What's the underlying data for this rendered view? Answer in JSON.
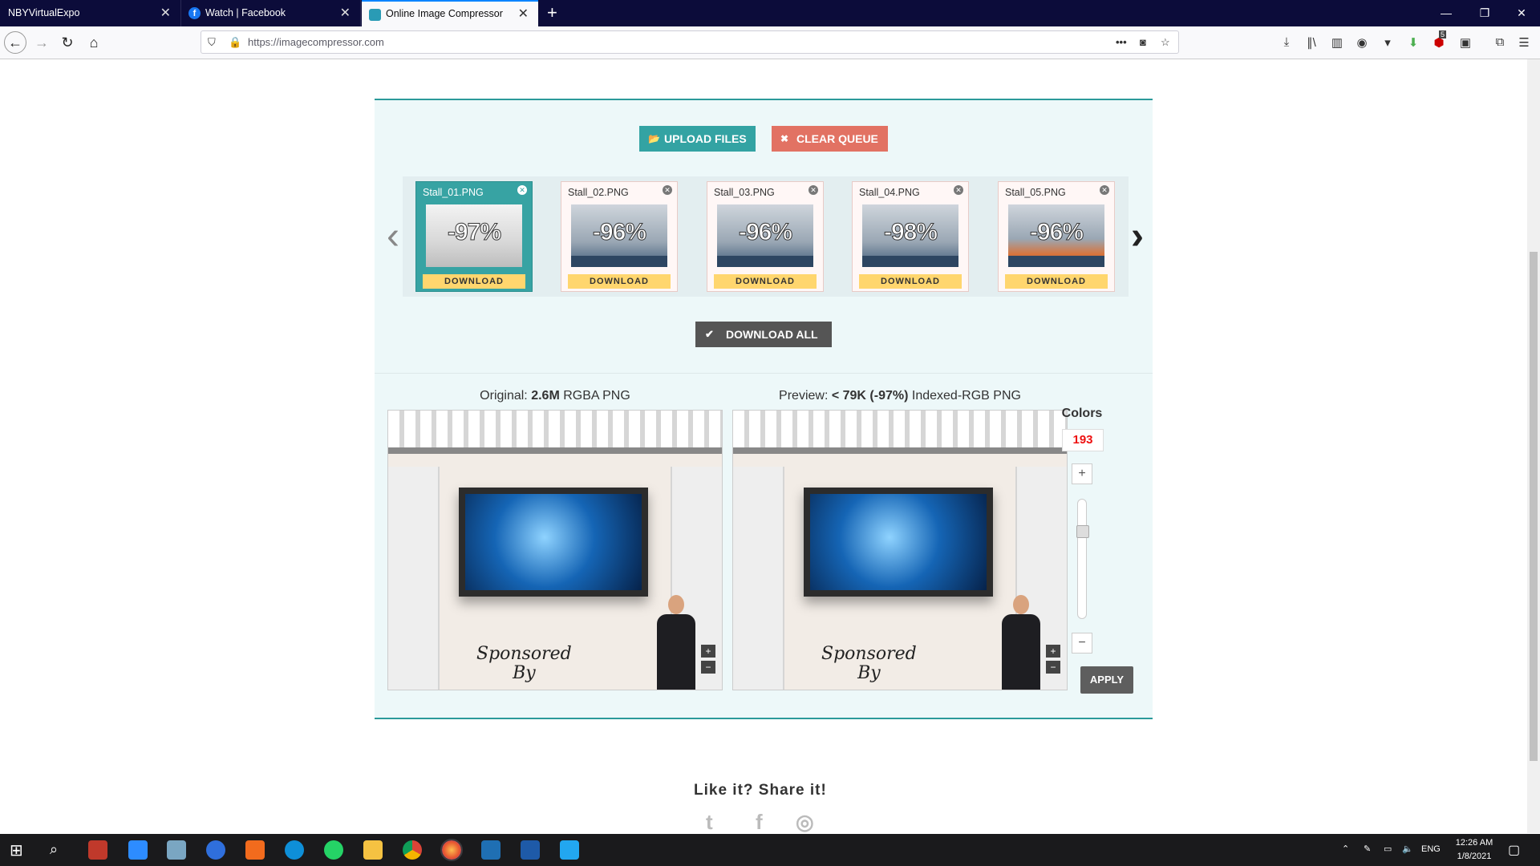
{
  "browser": {
    "tabs": [
      {
        "title": "NBYVirtualExpo"
      },
      {
        "title": "Watch | Facebook"
      },
      {
        "title": "Online Image Compressor"
      }
    ],
    "url": "https://imagecompressor.com",
    "new_tab_symbol": "+",
    "tab_close_symbol": "✕",
    "addon_badge": "5"
  },
  "toolbar": {
    "upload_label": "UPLOAD FILES",
    "clear_label": "CLEAR QUEUE",
    "download_all_label": "DOWNLOAD ALL"
  },
  "files": [
    {
      "name": "Stall_01.PNG",
      "savings": "-97%",
      "download_label": "DOWNLOAD",
      "active": true
    },
    {
      "name": "Stall_02.PNG",
      "savings": "-96%",
      "download_label": "DOWNLOAD",
      "active": false
    },
    {
      "name": "Stall_03.PNG",
      "savings": "-96%",
      "download_label": "DOWNLOAD",
      "active": false
    },
    {
      "name": "Stall_04.PNG",
      "savings": "-98%",
      "download_label": "DOWNLOAD",
      "active": false
    },
    {
      "name": "Stall_05.PNG",
      "savings": "-96%",
      "download_label": "DOWNLOAD",
      "active": false
    }
  ],
  "compare": {
    "original_prefix": "Original: ",
    "original_size": "2.6M",
    "original_format": " RGBA PNG",
    "preview_prefix": "Preview: ",
    "preview_size": "< 79K (-97%)",
    "preview_format": " Indexed-RGB PNG",
    "image_text_line1": "Sponsored",
    "image_text_line2": "By"
  },
  "colors": {
    "label": "Colors",
    "value": "193",
    "slider_level": 0.25,
    "apply_label": "APPLY"
  },
  "share": {
    "title": "Like it? Share it!"
  },
  "taskbar": {
    "lang": "ENG",
    "time": "12:26 AM",
    "date": "1/8/2021"
  },
  "theme": {
    "accent": "#33a3a3",
    "clear": "#e27263",
    "download": "#ffd66e",
    "colors_value": "#ee1111"
  }
}
